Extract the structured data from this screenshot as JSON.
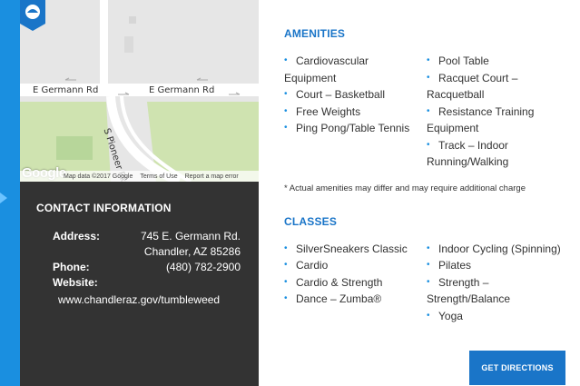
{
  "map": {
    "roads": {
      "germann_left": "E Germann Rd",
      "germann_right": "E Germann Rd",
      "pioneer": "S Pioneer Pkwy"
    },
    "google_logo": "Google",
    "footer": {
      "map_data": "Map data ©2017 Google",
      "terms": "Terms of Use",
      "report": "Report a map error"
    },
    "pin_icon": "location-pin-icon"
  },
  "contact": {
    "title": "CONTACT INFORMATION",
    "address_label": "Address:",
    "address_line1": "745 E. Germann Rd.",
    "address_line2": "Chandler, AZ 85286",
    "phone_label": "Phone:",
    "phone": "(480) 782-2900",
    "website_label": "Website:",
    "website": "www.chandleraz.gov/tumbleweed"
  },
  "amenities": {
    "title": "AMENITIES",
    "col1": [
      "Cardiovascular",
      "Equipment",
      "Court – Basketball",
      "Free Weights",
      "Ping Pong/Table Tennis"
    ],
    "col2": [
      "Pool Table",
      "Racquet Court –",
      "Racquetball",
      "Resistance Training",
      "Equipment",
      "Track – Indoor",
      "Running/Walking"
    ],
    "note": "* Actual amenities may differ and may require additional charge"
  },
  "classes": {
    "title": "CLASSES",
    "col1": [
      "SilverSneakers Classic",
      "Cardio",
      "Cardio & Strength",
      "Dance – Zumba®"
    ],
    "col2": [
      "Indoor Cycling (Spinning)",
      "Pilates",
      "Strength –",
      "Strength/Balance",
      "Yoga"
    ]
  },
  "directions_button": "GET DIRECTIONS",
  "colors": {
    "accent": "#1a75c8",
    "background": "#1a8fe0",
    "panel": "#333333"
  }
}
